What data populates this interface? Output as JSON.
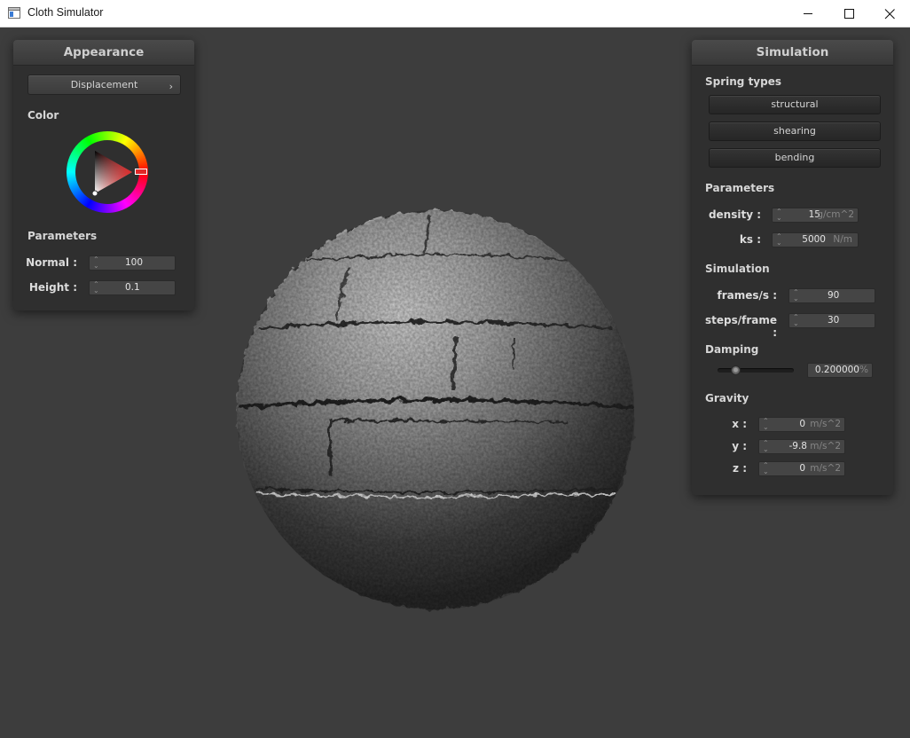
{
  "window": {
    "title": "Cloth Simulator",
    "icon": "app-window-icon"
  },
  "appearance": {
    "title": "Appearance",
    "shader_popup": "Displacement",
    "color_label": "Color",
    "selected_color": "#e02828",
    "parameters_label": "Parameters",
    "fields": [
      {
        "label": "Normal :",
        "value": "100"
      },
      {
        "label": "Height :",
        "value": "0.1"
      }
    ]
  },
  "simulation": {
    "title": "Simulation",
    "spring_types_label": "Spring types",
    "spring_buttons": [
      "structural",
      "shearing",
      "bending"
    ],
    "parameters_label": "Parameters",
    "params": [
      {
        "label": "density :",
        "value": "15",
        "unit": "g/cm^2"
      },
      {
        "label": "ks :",
        "value": "5000",
        "unit": "N/m"
      }
    ],
    "simulation_label": "Simulation",
    "sim_fields": [
      {
        "label": "frames/s :",
        "value": "90"
      },
      {
        "label": "steps/frame :",
        "value": "30"
      }
    ],
    "damping_label": "Damping",
    "damping": {
      "value": "0.200000",
      "unit": "%",
      "slider_fraction": 0.2
    },
    "gravity_label": "Gravity",
    "gravity": [
      {
        "label": "x :",
        "value": "0",
        "unit": "m/s^2"
      },
      {
        "label": "y :",
        "value": "-9.8",
        "unit": "m/s^2"
      },
      {
        "label": "z :",
        "value": "0",
        "unit": "m/s^2"
      }
    ]
  }
}
